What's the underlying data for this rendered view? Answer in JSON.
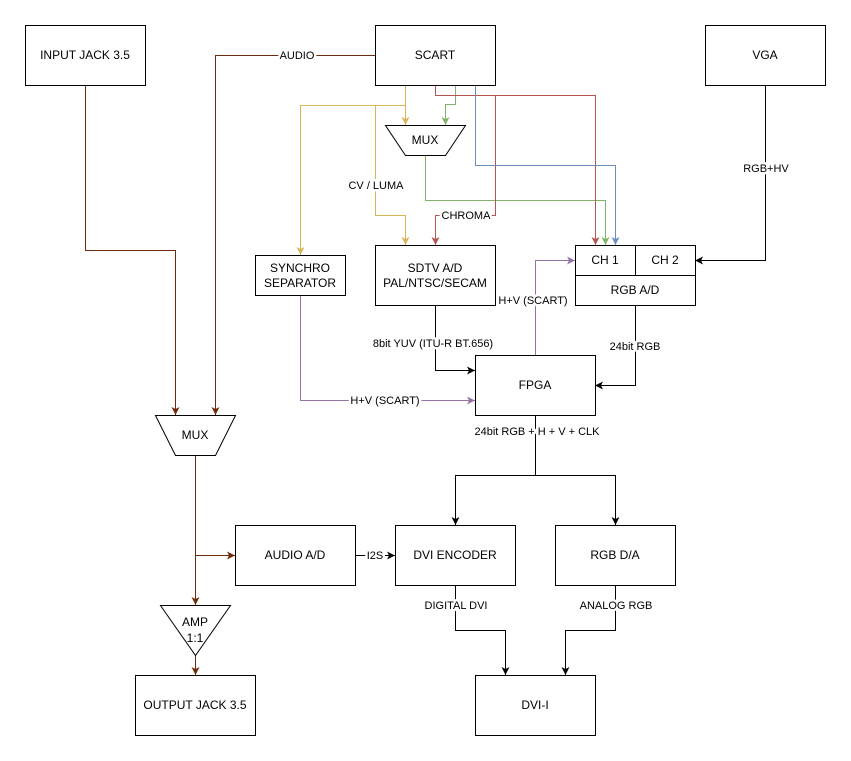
{
  "colors": {
    "audio": "#6e2b0b",
    "luma": "#d6b656",
    "chroma": "#b85450",
    "green": "#82b366",
    "blue": "#6c8ebf",
    "sync": "#9673a6",
    "digital": "#000000"
  },
  "nodes": {
    "input_jack": "INPUT JACK 3.5",
    "scart": "SCART",
    "vga": "VGA",
    "mux_video": "MUX",
    "synchro_separator": {
      "line1": "SYNCHRO",
      "line2": "SEPARATOR"
    },
    "sdtv_ad": {
      "line1": "SDTV A/D",
      "line2": "PAL/NTSC/SECAM"
    },
    "rgb_ad": {
      "ch1": "CH 1",
      "ch2": "CH 2",
      "label": "RGB A/D"
    },
    "fpga": "FPGA",
    "mux_audio": "MUX",
    "audio_ad": "AUDIO A/D",
    "dvi_encoder": "DVI ENCODER",
    "rgb_da": "RGB D/A",
    "amp": {
      "line1": "AMP",
      "line2": "1:1"
    },
    "output_jack": "OUTPUT JACK 3.5",
    "dvi_i": "DVI-I"
  },
  "edge_labels": {
    "audio": "AUDIO",
    "cv_luma": "CV / LUMA",
    "chroma": "CHROMA",
    "rgb_hv": "RGB+HV",
    "hv_scart_fpga": "H+V (SCART)",
    "hv_scart_ch1": "H+V (SCART)",
    "yuv": "8bit YUV (ITU-R BT.656)",
    "rgb24": "24bit RGB",
    "fpga_out": "24bit RGB + H + V + CLK",
    "i2s": "I2S",
    "digital_dvi": "DIGITAL DVI",
    "analog_rgb": "ANALOG RGB"
  }
}
